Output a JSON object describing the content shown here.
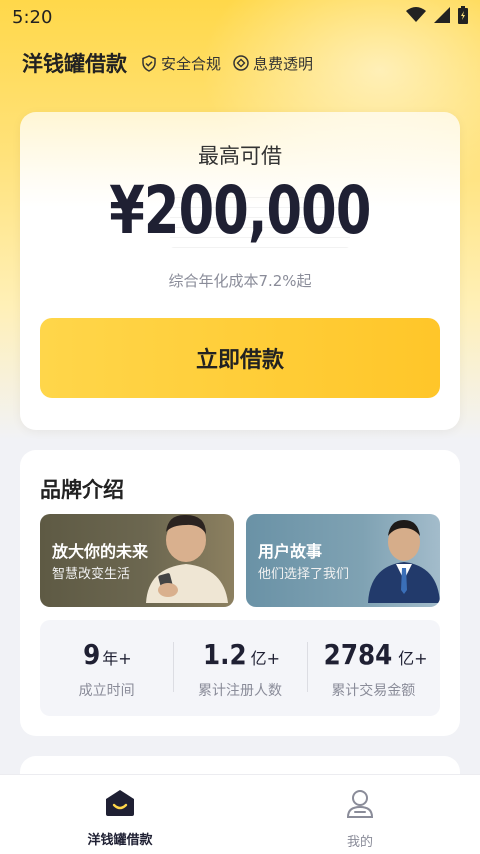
{
  "status_bar": {
    "time": "5:20",
    "icons": [
      "wifi-icon",
      "signal-icon",
      "battery-icon"
    ]
  },
  "header": {
    "title": "洋钱罐借款",
    "tags": [
      {
        "icon": "shield-check-icon",
        "label": "安全合规"
      },
      {
        "icon": "diamond-icon",
        "label": "息费透明"
      }
    ]
  },
  "loan_card": {
    "label": "最高可借",
    "amount": "¥200,000",
    "rate_text": "综合年化成本7.2%起",
    "button_label": "立即借款"
  },
  "brand": {
    "title": "品牌介绍",
    "promos": [
      {
        "title": "放大你的未来",
        "subtitle": "智慧改变生活"
      },
      {
        "title": "用户故事",
        "subtitle": "他们选择了我们"
      }
    ],
    "stats": [
      {
        "value": "9",
        "unit": "年+",
        "label": "成立时间"
      },
      {
        "value": "1.2",
        "unit": "亿+",
        "label": "累计注册人数"
      },
      {
        "value": "2784",
        "unit": "亿+",
        "label": "累计交易金额"
      }
    ]
  },
  "tabbar": {
    "items": [
      {
        "label": "洋钱罐借款",
        "icon": "home-icon",
        "active": true
      },
      {
        "label": "我的",
        "icon": "profile-icon",
        "active": false
      }
    ]
  },
  "colors": {
    "brand_yellow": "#ffd64a",
    "button_yellow_end": "#ffc629",
    "text_dark": "#1f2033",
    "text_muted": "#8a8c99",
    "background": "#f1f2f6"
  }
}
